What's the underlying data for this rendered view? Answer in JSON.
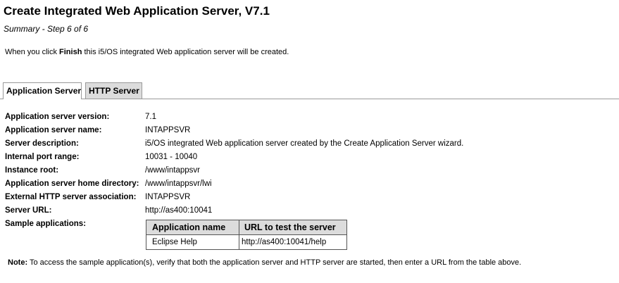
{
  "header": {
    "title": "Create Integrated Web Application Server, V7.1",
    "subtitle": "Summary - Step 6 of 6"
  },
  "intro": {
    "prefix": "When you click ",
    "bold": "Finish",
    "suffix": " this i5/OS integrated Web application server will be created."
  },
  "tabs": [
    {
      "label": "Application Server",
      "active": true
    },
    {
      "label": "HTTP Server",
      "active": false
    }
  ],
  "properties": [
    {
      "label": "Application server version:",
      "value": "7.1"
    },
    {
      "label": "Application server name:",
      "value": "INTAPPSVR"
    },
    {
      "label": "Server description:",
      "value": "i5/OS integrated Web application server created by the Create Application Server wizard."
    },
    {
      "label": "Internal port range:",
      "value": "10031 - 10040"
    },
    {
      "label": "Instance root:",
      "value": "/www/intappsvr"
    },
    {
      "label": "Application server home directory:",
      "value": "/www/intappsvr/lwi"
    },
    {
      "label": "External HTTP server association:",
      "value": "INTAPPSVR"
    },
    {
      "label": "Server URL:",
      "value": "http://as400:10041"
    },
    {
      "label": "Sample applications:",
      "value": ""
    }
  ],
  "sample_table": {
    "headers": [
      "Application name",
      "URL to test the server"
    ],
    "rows": [
      [
        "Eclipse Help",
        "http://as400:10041/help"
      ]
    ]
  },
  "note": {
    "bold": "Note:",
    "text": " To access the sample application(s), verify that both the application server and HTTP server are started, then enter a URL from the table above."
  }
}
